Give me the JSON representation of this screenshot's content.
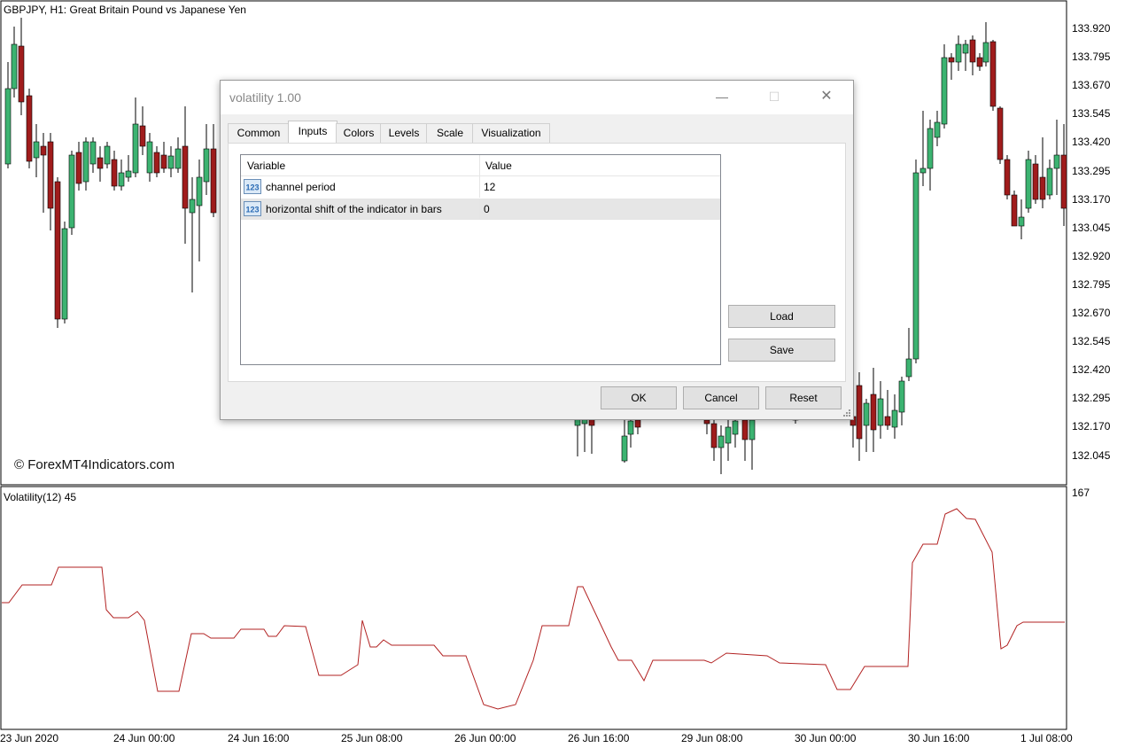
{
  "chart": {
    "title": "GBPJPY, H1:  Great Britain Pound vs Japanese Yen",
    "watermark": "© ForexMT4Indicators.com",
    "price_axis": [
      "133.920",
      "133.795",
      "133.670",
      "133.545",
      "133.420",
      "133.295",
      "133.170",
      "133.045",
      "132.920",
      "132.795",
      "132.670",
      "132.545",
      "132.420",
      "132.295",
      "132.170",
      "132.045"
    ],
    "time_axis": [
      "23 Jun 2020",
      "24 Jun 00:00",
      "24 Jun 16:00",
      "25 Jun 08:00",
      "26 Jun 00:00",
      "26 Jun 16:00",
      "29 Jun 08:00",
      "30 Jun 00:00",
      "30 Jun 16:00",
      "1 Jul 08:00"
    ],
    "colors": {
      "bull": "#3cb371",
      "bear": "#a01c1c",
      "wick": "#000000",
      "indicator_line": "#b22222",
      "grid_line": "#000000"
    }
  },
  "indicator": {
    "label": "Volatility(12) 45",
    "scale_max": "167"
  },
  "dialog": {
    "title": "volatility 1.00",
    "window_buttons": {
      "minimize": "—",
      "maximize": "☐",
      "close": "✕"
    },
    "tabs": [
      "Common",
      "Inputs",
      "Colors",
      "Levels",
      "Scale",
      "Visualization"
    ],
    "active_tab": "Inputs",
    "grid": {
      "headers": [
        "Variable",
        "Value"
      ],
      "rows": [
        {
          "variable": "channel period",
          "value": "12",
          "icon": "int-type-icon"
        },
        {
          "variable": "horizontal shift of the indicator in bars",
          "value": "0",
          "icon": "int-type-icon"
        }
      ],
      "icon_text": "123"
    },
    "side_buttons": {
      "load": "Load",
      "save": "Save"
    },
    "bottom_buttons": {
      "ok": "OK",
      "cancel": "Cancel",
      "reset": "Reset"
    }
  }
}
